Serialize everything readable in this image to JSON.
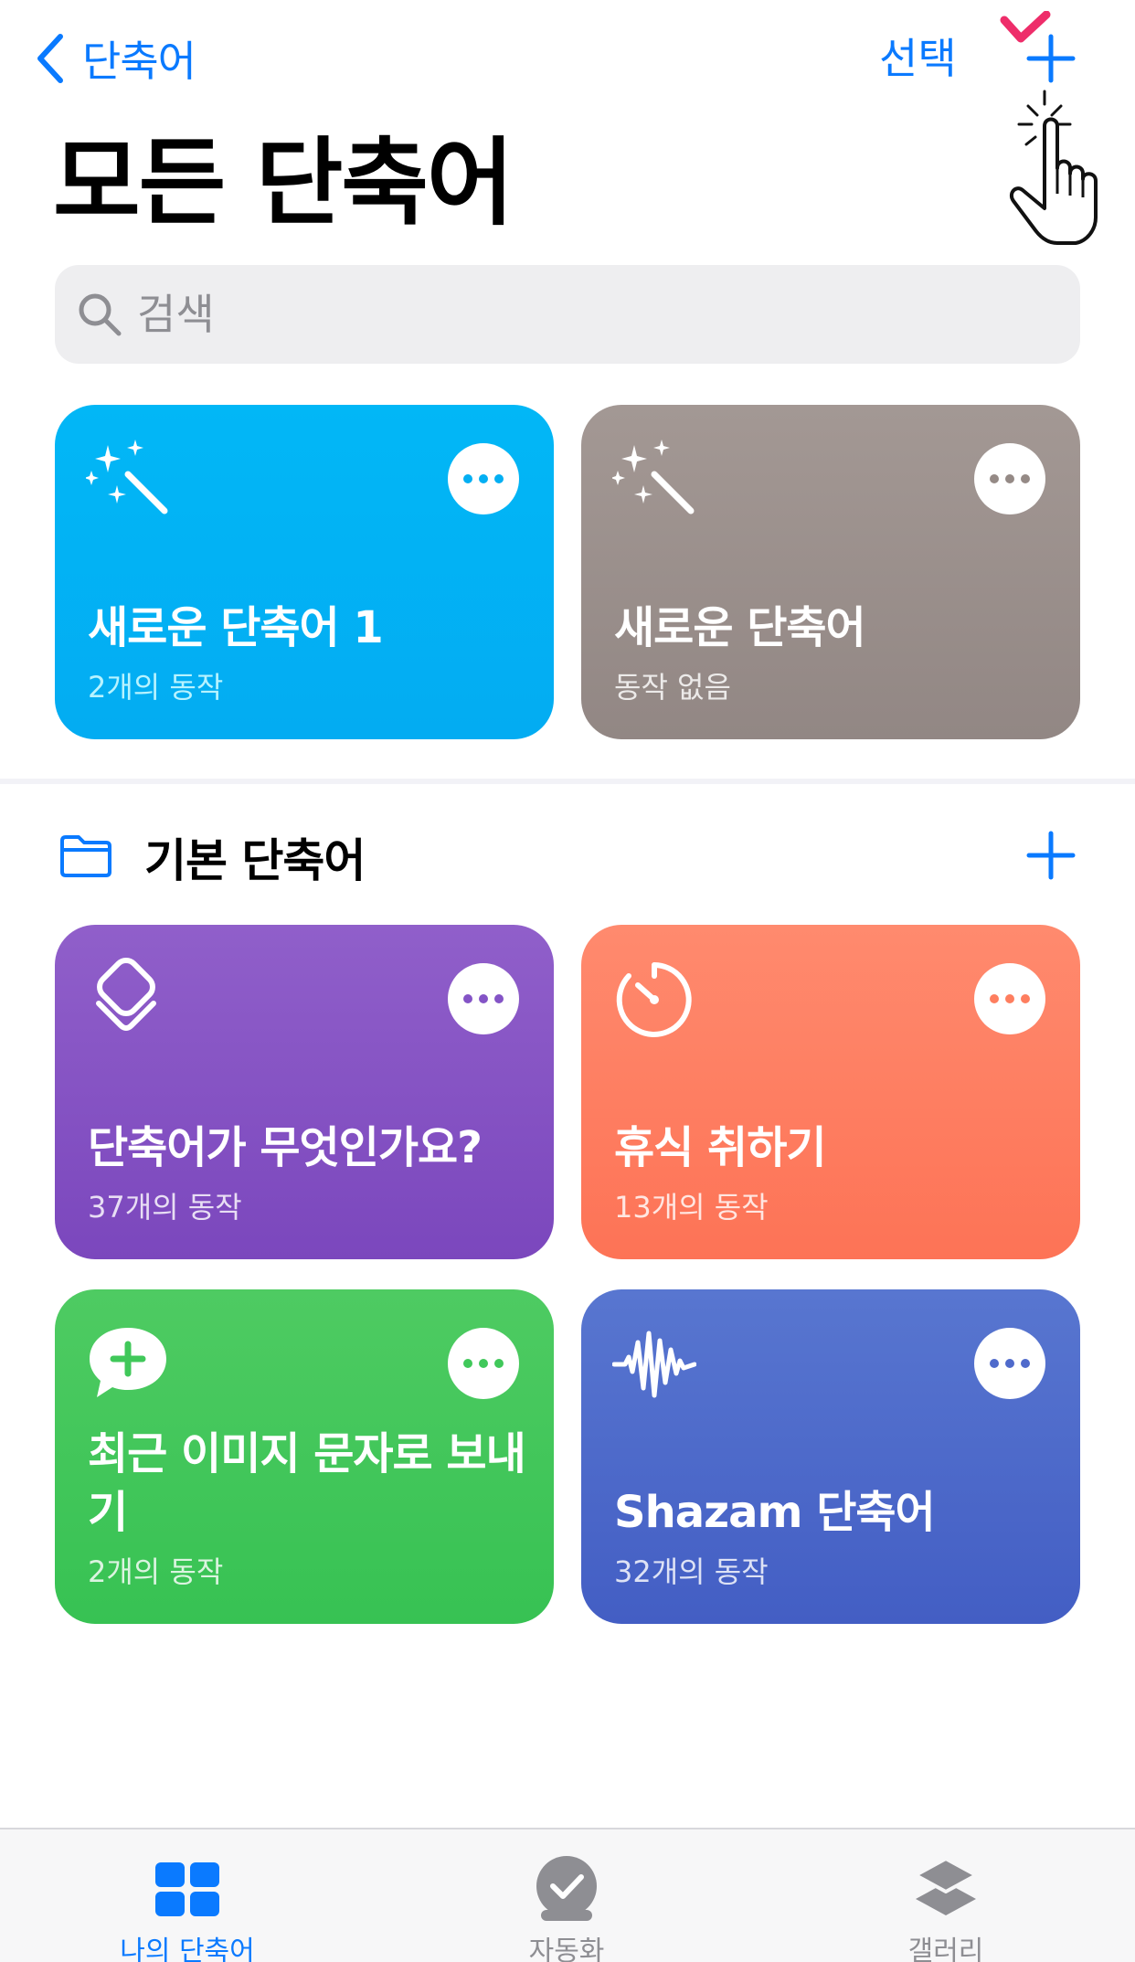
{
  "colors": {
    "accent": "#0a7aff",
    "tile_blue": "#04b2f5",
    "tile_gray": "#9a8f8c",
    "tile_purple": "#8756c8",
    "tile_orange": "#fe7e5f",
    "tile_green": "#40c85a",
    "tile_indigo": "#4f6acb",
    "hint_marker": "#ee2d6a"
  },
  "nav": {
    "back_label": "단축어",
    "select_label": "선택"
  },
  "page": {
    "title": "모든 단축어"
  },
  "search": {
    "placeholder": "검색",
    "icon": "magnifier-icon"
  },
  "shortcuts": [
    {
      "title": "새로운 단축어 1",
      "subtitle": "2개의 동작",
      "icon": "magic-wand-icon"
    },
    {
      "title": "새로운 단축어",
      "subtitle": "동작 없음",
      "icon": "magic-wand-icon"
    }
  ],
  "folder": {
    "title": "기본 단축어",
    "icon": "folder-icon",
    "items": [
      {
        "title": "단축어가 무엇인가요?",
        "subtitle": "37개의 동작",
        "icon": "layers-icon"
      },
      {
        "title": "휴식 취하기",
        "subtitle": "13개의 동작",
        "icon": "timer-icon"
      },
      {
        "title": "최근 이미지 문자로 보내기",
        "subtitle": "2개의 동작",
        "icon": "message-plus-icon"
      },
      {
        "title": "Shazam 단축어",
        "subtitle": "32개의 동작",
        "icon": "waveform-icon"
      }
    ]
  },
  "tabbar": {
    "tabs": [
      {
        "label": "나의 단축어",
        "icon": "grid-icon",
        "selected": true
      },
      {
        "label": "자동화",
        "icon": "checkmark-circle-icon",
        "selected": false
      },
      {
        "label": "갤러리",
        "icon": "stack-icon",
        "selected": false
      }
    ]
  }
}
